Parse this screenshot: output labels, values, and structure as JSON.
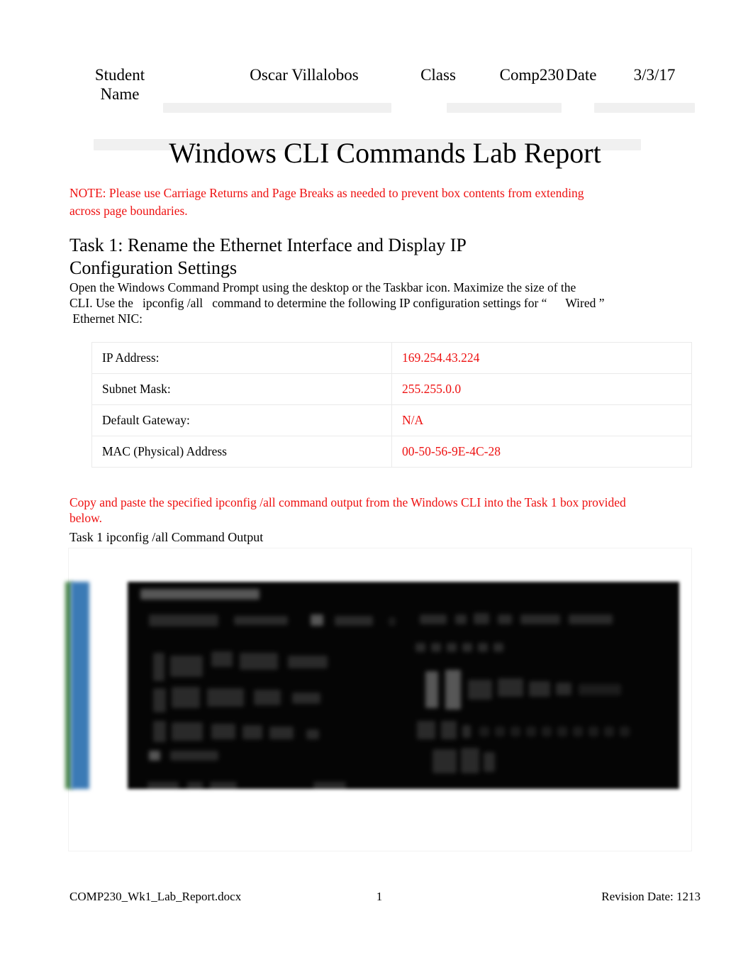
{
  "header": {
    "student_name_label": "Student Name",
    "student_name_value": "Oscar Villalobos",
    "class_label": "Class",
    "class_value": "Comp230",
    "date_label": "Date",
    "date_value": "3/3/17"
  },
  "title": "Windows CLI Commands Lab Report",
  "note": "NOTE: Please use Carriage Returns and Page Breaks as needed to prevent box contents from extending across page boundaries.",
  "task_heading": "Task 1: Rename the Ethernet Interface and Display IP Configuration Settings",
  "body_paragraph": {
    "line1": "Open the Windows Command Prompt using the desktop or the Taskbar icon. Maximize the size of the",
    "line2": "CLI. Use the   ipconfig /all   command to determine the following IP configuration settings for “      Wired ”",
    "line3": " Ethernet NIC:"
  },
  "ip_table": {
    "rows": [
      {
        "key": "IP Address:",
        "value": "169.254.43.224"
      },
      {
        "key": "Subnet Mask:",
        "value": "255.255.0.0"
      },
      {
        "key": "Default Gateway:",
        "value": "N/A"
      },
      {
        "key": "MAC (Physical) Address",
        "value": "00-50-56-9E-4C-28"
      }
    ]
  },
  "instruction": "Copy and paste the specified ipconfig /all command output from the Windows CLI into the Task 1 box provided below.",
  "output_caption": "Task 1 ipconfig /all Command Output",
  "cli_screenshot": {
    "description": "pasted-command-prompt-screenshot",
    "legible": false
  },
  "footer": {
    "file_name": "COMP230_Wk1_Lab_Report.docx",
    "page_number": "1",
    "revision": "Revision Date: 1213"
  },
  "colors": {
    "red": "#ee1111",
    "field_shade": "#f0f0f0",
    "table_border": "#eaeaea",
    "terminal_bg": "#050505",
    "strip_green": "#4f8a4f",
    "strip_blue": "#3b7ab5"
  }
}
